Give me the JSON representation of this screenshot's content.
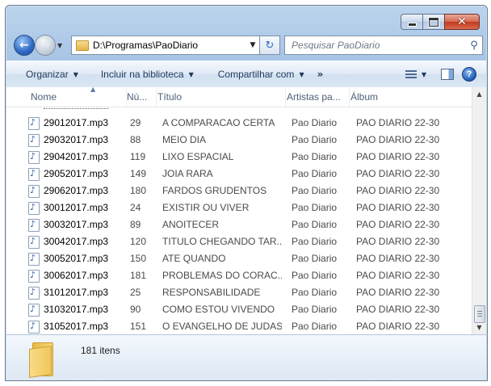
{
  "window": {
    "caption": {
      "minimize_icon": "minimize-icon",
      "maximize_icon": "maximize-icon",
      "close_glyph": "✕"
    }
  },
  "nav": {
    "back_glyph": "←",
    "forward_glyph": "→",
    "history_glyph": "▼",
    "address": "D:\\Programas\\PaoDiario",
    "address_drop": "▼",
    "refresh_glyph": "↻",
    "search_placeholder": "Pesquisar PaoDiario",
    "search_glyph": "⚲"
  },
  "toolbar": {
    "organize": "Organizar",
    "include": "Incluir na biblioteca",
    "share": "Compartilhar com",
    "more": "»",
    "dropdown_glyph": "▼",
    "help": "?"
  },
  "columns": [
    {
      "label": "Nome"
    },
    {
      "label": "Nú..."
    },
    {
      "label": "Título"
    },
    {
      "label": "Artistas pa..."
    },
    {
      "label": "Álbum"
    }
  ],
  "rows": [
    {
      "name": "29012017.mp3",
      "num": "29",
      "title": "A COMPARACAO CERTA",
      "artist": "Pao Diario",
      "album": "PAO DIARIO 22-30"
    },
    {
      "name": "29032017.mp3",
      "num": "88",
      "title": "MEIO DIA",
      "artist": "Pao Diario",
      "album": "PAO DIARIO 22-30"
    },
    {
      "name": "29042017.mp3",
      "num": "119",
      "title": "LIXO ESPACIAL",
      "artist": "Pao Diario",
      "album": "PAO DIARIO 22-30"
    },
    {
      "name": "29052017.mp3",
      "num": "149",
      "title": "JOIA RARA",
      "artist": "Pao Diario",
      "album": "PAO DIARIO 22-30"
    },
    {
      "name": "29062017.mp3",
      "num": "180",
      "title": "FARDOS GRUDENTOS",
      "artist": "Pao Diario",
      "album": "PAO DIARIO 22-30"
    },
    {
      "name": "30012017.mp3",
      "num": "24",
      "title": "EXISTIR OU VIVER",
      "artist": "Pao Diario",
      "album": "PAO DIARIO 22-30"
    },
    {
      "name": "30032017.mp3",
      "num": "89",
      "title": "ANOITECER",
      "artist": "Pao Diario",
      "album": "PAO DIARIO 22-30"
    },
    {
      "name": "30042017.mp3",
      "num": "120",
      "title": "TITULO CHEGANDO TAR...",
      "artist": "Pao Diario",
      "album": "PAO DIARIO 22-30"
    },
    {
      "name": "30052017.mp3",
      "num": "150",
      "title": "ATE QUANDO",
      "artist": "Pao Diario",
      "album": "PAO DIARIO 22-30"
    },
    {
      "name": "30062017.mp3",
      "num": "181",
      "title": "PROBLEMAS DO CORAC...",
      "artist": "Pao Diario",
      "album": "PAO DIARIO 22-30"
    },
    {
      "name": "31012017.mp3",
      "num": "25",
      "title": "RESPONSABILIDADE",
      "artist": "Pao Diario",
      "album": "PAO DIARIO 22-30"
    },
    {
      "name": "31032017.mp3",
      "num": "90",
      "title": "COMO ESTOU VIVENDO",
      "artist": "Pao Diario",
      "album": "PAO DIARIO 22-30"
    },
    {
      "name": "31052017.mp3",
      "num": "151",
      "title": "O EVANGELHO  DE JUDAS",
      "artist": "Pao Diario",
      "album": "PAO DIARIO 22-30"
    }
  ],
  "scrollbar": {
    "up_glyph": "▲",
    "down_glyph": "▼"
  },
  "details": {
    "count": "181 itens"
  }
}
